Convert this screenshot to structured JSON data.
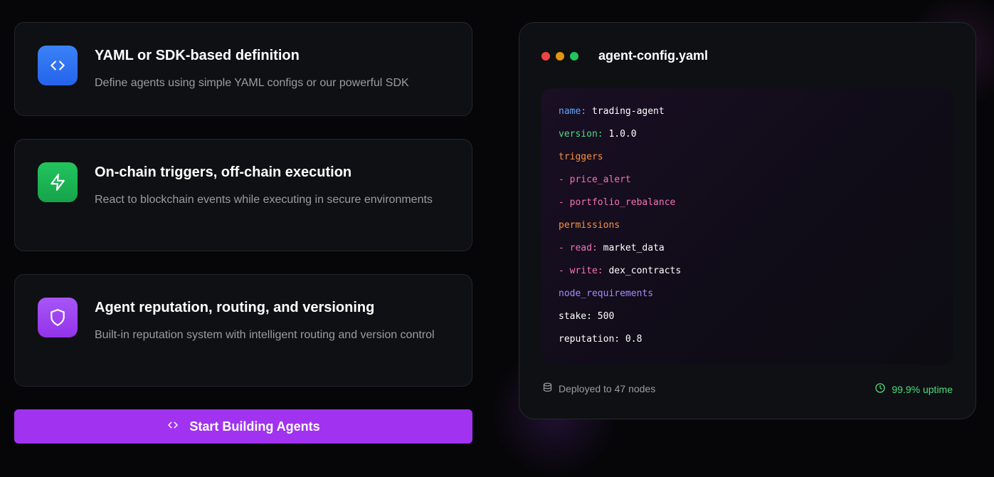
{
  "features": [
    {
      "icon": "code-brackets-icon",
      "title": "YAML or SDK-based definition",
      "description": "Define agents using simple YAML configs or our powerful SDK"
    },
    {
      "icon": "lightning-bolt-icon",
      "title": "On-chain triggers, off-chain execution",
      "description": "React to blockchain events while executing in secure environments"
    },
    {
      "icon": "shield-icon",
      "title": "Agent reputation, routing, and versioning",
      "description": "Built-in reputation system with intelligent routing and version control"
    }
  ],
  "cta": {
    "label": "Start Building Agents",
    "icon": "code-brackets-icon"
  },
  "config": {
    "filename": "agent-config.yaml",
    "lines": {
      "name_key": "name:",
      "name_val": "trading-agent",
      "version_key": "version:",
      "version_val": "1.0.0",
      "triggers": "triggers",
      "trigger_1": "- price_alert",
      "trigger_2": "- portfolio_rebalance",
      "permissions": "permissions",
      "perm_read_key": "- read:",
      "perm_read_val": "market_data",
      "perm_write_key": "- write:",
      "perm_write_val": "dex_contracts",
      "node_requirements": "node_requirements",
      "stake": "stake: 500",
      "reputation": "reputation: 0.8"
    },
    "footer": {
      "deployed": "Deployed to 47 nodes",
      "uptime": "99.9% uptime"
    }
  },
  "colors": {
    "accent": "#a133f0",
    "blue": "#3b82f6",
    "green": "#22c55e",
    "purple": "#a855f7"
  }
}
